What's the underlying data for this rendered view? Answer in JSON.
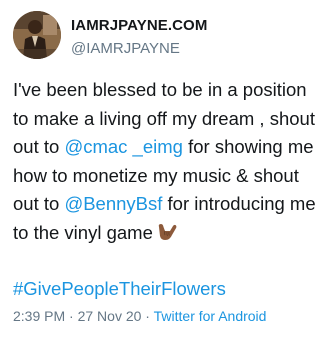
{
  "user": {
    "display_name": "IAMRJPAYNE.COM",
    "handle": "@IAMRJPAYNE"
  },
  "tweet": {
    "text_1": "I've been blessed to be in a position to make a living off my dream , shout out to ",
    "mention_1": "@cmac _eimg",
    "text_2": " for showing me how to monetize my music & shout out to ",
    "mention_2": "@BennyBsf",
    "text_3": " for introducing me to the vinyl game",
    "emoji": "call-me-hand-medium-dark-skin-tone",
    "hashtag": "#GivePeopleTheirFlowers"
  },
  "meta": {
    "time": "2:39 PM",
    "separator_1": " · ",
    "date": "27 Nov 20",
    "separator_2": " · ",
    "source": "Twitter for Android"
  },
  "colors": {
    "link": "#1b95e0",
    "text": "#14171a",
    "secondary": "#657786"
  }
}
